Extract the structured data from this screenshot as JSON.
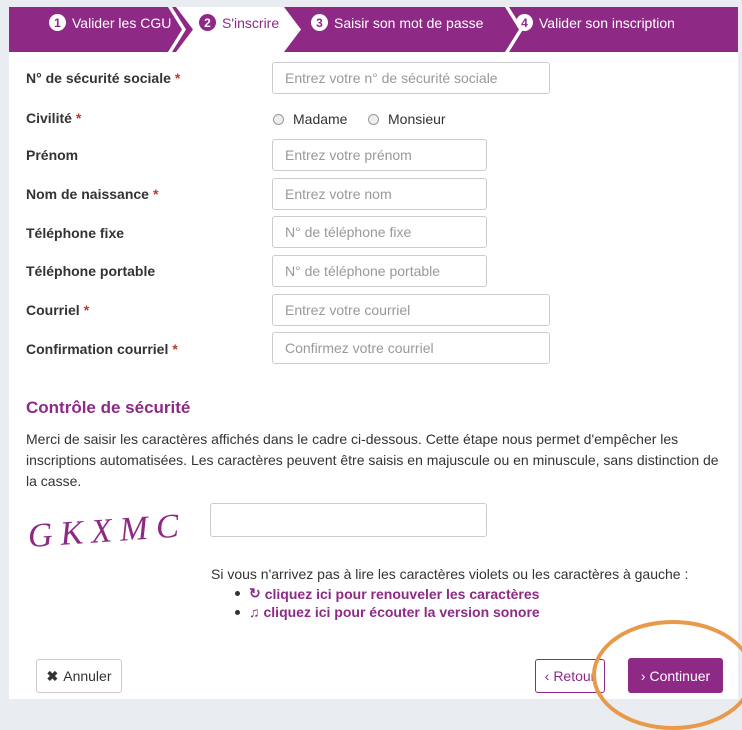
{
  "steps": [
    {
      "number": "1",
      "label": "Valider les CGU"
    },
    {
      "number": "2",
      "label": "S'inscrire"
    },
    {
      "number": "3",
      "label": "Saisir son mot de passe"
    },
    {
      "number": "4",
      "label": "Valider son inscription"
    }
  ],
  "form": {
    "required_mark": "*",
    "nir_label": "N° de sécurité sociale",
    "nir_placeholder": "Entrez votre n° de sécurité sociale",
    "civilite_label": "Civilité",
    "civilite_options": [
      "Madame",
      "Monsieur"
    ],
    "prenom_label": "Prénom",
    "prenom_placeholder": "Entrez votre prénom",
    "nom_label": "Nom de naissance",
    "nom_placeholder": "Entrez votre nom",
    "tel_fixe_label": "Téléphone fixe",
    "tel_fixe_placeholder": "N° de téléphone fixe",
    "tel_portable_label": "Téléphone portable",
    "tel_portable_placeholder": "N° de téléphone portable",
    "courriel_label": "Courriel",
    "courriel_placeholder": "Entrez votre courriel",
    "confirm_label": "Confirmation courriel",
    "confirm_placeholder": "Confirmez votre courriel"
  },
  "security": {
    "title": "Contrôle de sécurité",
    "text": "Merci de saisir les caractères affichés dans le cadre ci-dessous. Cette étape nous permet d'empêcher les inscriptions automatisées. Les caractères peuvent être saisis en majuscule ou en minuscule, sans distinction de la casse.",
    "captcha_text": "GKXMC",
    "help_text": "Si vous n'arrivez pas à lire les caractères violets ou les caractères à gauche :",
    "renew_link": "cliquez ici pour renouveler les caractères",
    "audio_link": "cliquez ici pour écouter la version sonore"
  },
  "buttons": {
    "annuler": "Annuler",
    "retour": "Retour",
    "continuer": "Continuer"
  },
  "colors": {
    "brand": "#8e2a86",
    "highlight": "#e89a4a"
  }
}
